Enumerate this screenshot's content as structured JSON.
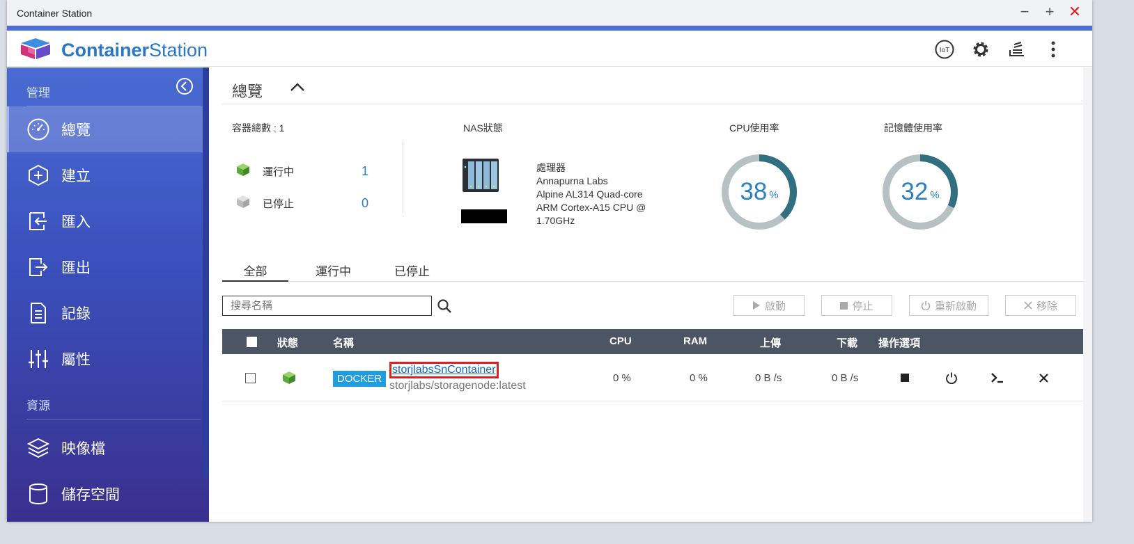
{
  "window": {
    "title": "Container Station"
  },
  "brand": {
    "bold": "Container",
    "light": "Station"
  },
  "header_icons": [
    "iot-icon",
    "gear-icon",
    "stack-icon",
    "more-vertical-icon"
  ],
  "header": {
    "iot_label": "IoT"
  },
  "sidebar": {
    "section_manage": "管理",
    "items": [
      {
        "label": "總覽",
        "icon": "dashboard-icon",
        "active": true
      },
      {
        "label": "建立",
        "icon": "create-icon"
      },
      {
        "label": "匯入",
        "icon": "import-icon"
      },
      {
        "label": "匯出",
        "icon": "export-icon"
      },
      {
        "label": "記錄",
        "icon": "log-icon"
      },
      {
        "label": "屬性",
        "icon": "preferences-icon"
      }
    ],
    "section_resources": "資源",
    "resource_items": [
      {
        "label": "映像檔",
        "icon": "layers-icon"
      },
      {
        "label": "儲存空間",
        "icon": "storage-icon"
      }
    ]
  },
  "page": {
    "title": "總覽"
  },
  "stats": {
    "container_total_label": "容器總數 : 1",
    "running_label": "運行中",
    "running_count": "1",
    "stopped_label": "已停止",
    "stopped_count": "0",
    "nas_status_label": "NAS狀態",
    "processor_label": "處理器",
    "processor_lines": [
      "Annapurna Labs",
      "Alpine AL314 Quad-core",
      "ARM Cortex-A15 CPU @",
      "1.70GHz"
    ],
    "cpu_label": "CPU使用率",
    "cpu_value": "38",
    "cpu_fraction": 0.38,
    "mem_label": "記憶體使用率",
    "mem_value": "32",
    "mem_fraction": 0.32,
    "percent_sign": "%",
    "colors": {
      "gauge_fill": "#2f6f80",
      "gauge_track": "#b7c1c3",
      "value": "#2b7fc4"
    }
  },
  "tabs": [
    "全部",
    "運行中",
    "已停止"
  ],
  "search": {
    "placeholder": "搜尋名稱"
  },
  "actions": {
    "start": "啟動",
    "stop": "停止",
    "restart": "重新啟動",
    "remove": "移除"
  },
  "table": {
    "headers": {
      "status": "狀態",
      "name": "名稱",
      "cpu": "CPU",
      "ram": "RAM",
      "upload": "上傳",
      "download": "下載",
      "ops": "操作選項"
    },
    "rows": [
      {
        "type": "DOCKER",
        "name": "storjlabsSnContainer",
        "image": "storjlabs/storagenode:latest",
        "cpu": "0 %",
        "ram": "0 %",
        "upload": "0 B /s",
        "download": "0 B /s"
      }
    ]
  }
}
